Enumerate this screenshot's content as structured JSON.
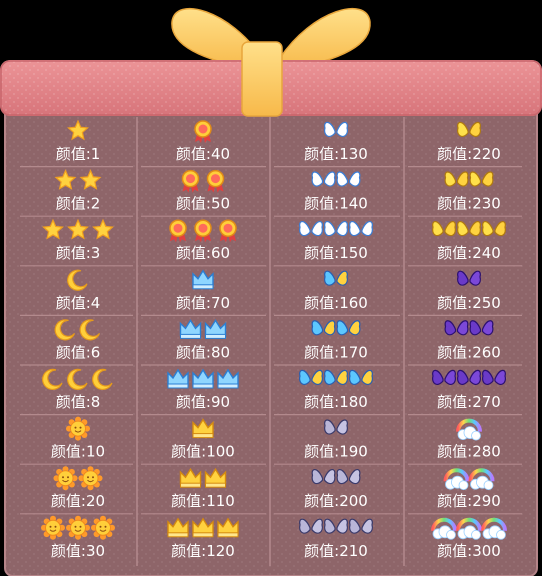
{
  "title": "",
  "label_prefix": "颜值:",
  "colors": {
    "lid": "#df7c80",
    "box_body": "#8e6569",
    "box_edge": "#b58589",
    "bow": "#fcc55f",
    "divider": "#b38a8d",
    "label_text": "#ffffff"
  },
  "columns": [
    {
      "icon": "star",
      "values": [
        1,
        2,
        3
      ]
    },
    {
      "icon": "moon",
      "values": [
        4,
        6,
        8
      ]
    },
    {
      "icon": "sun",
      "values": [
        10,
        20,
        30
      ]
    },
    {
      "icon": "medal",
      "values": [
        40,
        50,
        60
      ]
    },
    {
      "icon": "crown-blue",
      "values": [
        70,
        80,
        90
      ]
    },
    {
      "icon": "crown-gold",
      "values": [
        100,
        110,
        120
      ]
    },
    {
      "icon": "wings-white",
      "values": [
        130,
        140,
        150
      ]
    },
    {
      "icon": "wings-rainbow",
      "values": [
        160,
        170,
        180
      ]
    },
    {
      "icon": "wings-gray",
      "values": [
        190,
        200,
        210
      ]
    },
    {
      "icon": "wings-gold",
      "values": [
        220,
        230,
        240
      ]
    },
    {
      "icon": "wings-purple",
      "values": [
        250,
        260,
        270
      ]
    },
    {
      "icon": "rainbow-cloud",
      "values": [
        280,
        290,
        300
      ]
    }
  ],
  "table": [
    [
      {
        "icon": "star",
        "count": 1,
        "value": "1"
      },
      {
        "icon": "medal",
        "count": 1,
        "value": "40"
      },
      {
        "icon": "wings-white",
        "count": 1,
        "value": "130"
      },
      {
        "icon": "wings-gold",
        "count": 1,
        "value": "220"
      }
    ],
    [
      {
        "icon": "star",
        "count": 2,
        "value": "2"
      },
      {
        "icon": "medal",
        "count": 2,
        "value": "50"
      },
      {
        "icon": "wings-white",
        "count": 2,
        "value": "140"
      },
      {
        "icon": "wings-gold",
        "count": 2,
        "value": "230"
      }
    ],
    [
      {
        "icon": "star",
        "count": 3,
        "value": "3"
      },
      {
        "icon": "medal",
        "count": 3,
        "value": "60"
      },
      {
        "icon": "wings-white",
        "count": 3,
        "value": "150"
      },
      {
        "icon": "wings-gold",
        "count": 3,
        "value": "240"
      }
    ],
    [
      {
        "icon": "moon",
        "count": 1,
        "value": "4"
      },
      {
        "icon": "crown-blue",
        "count": 1,
        "value": "70"
      },
      {
        "icon": "wings-rainbow",
        "count": 1,
        "value": "160"
      },
      {
        "icon": "wings-purple",
        "count": 1,
        "value": "250"
      }
    ],
    [
      {
        "icon": "moon",
        "count": 2,
        "value": "6"
      },
      {
        "icon": "crown-blue",
        "count": 2,
        "value": "80"
      },
      {
        "icon": "wings-rainbow",
        "count": 2,
        "value": "170"
      },
      {
        "icon": "wings-purple",
        "count": 2,
        "value": "260"
      }
    ],
    [
      {
        "icon": "moon",
        "count": 3,
        "value": "8"
      },
      {
        "icon": "crown-blue",
        "count": 3,
        "value": "90"
      },
      {
        "icon": "wings-rainbow",
        "count": 3,
        "value": "180"
      },
      {
        "icon": "wings-purple",
        "count": 3,
        "value": "270"
      }
    ],
    [
      {
        "icon": "sun",
        "count": 1,
        "value": "10"
      },
      {
        "icon": "crown-gold",
        "count": 1,
        "value": "100"
      },
      {
        "icon": "wings-gray",
        "count": 1,
        "value": "190"
      },
      {
        "icon": "rainbow-cloud",
        "count": 1,
        "value": "280"
      }
    ],
    [
      {
        "icon": "sun",
        "count": 2,
        "value": "20"
      },
      {
        "icon": "crown-gold",
        "count": 2,
        "value": "110"
      },
      {
        "icon": "wings-gray",
        "count": 2,
        "value": "200"
      },
      {
        "icon": "rainbow-cloud",
        "count": 2,
        "value": "290"
      }
    ],
    [
      {
        "icon": "sun",
        "count": 3,
        "value": "30"
      },
      {
        "icon": "crown-gold",
        "count": 3,
        "value": "120"
      },
      {
        "icon": "wings-gray",
        "count": 3,
        "value": "210"
      },
      {
        "icon": "rainbow-cloud",
        "count": 3,
        "value": "300"
      }
    ]
  ]
}
